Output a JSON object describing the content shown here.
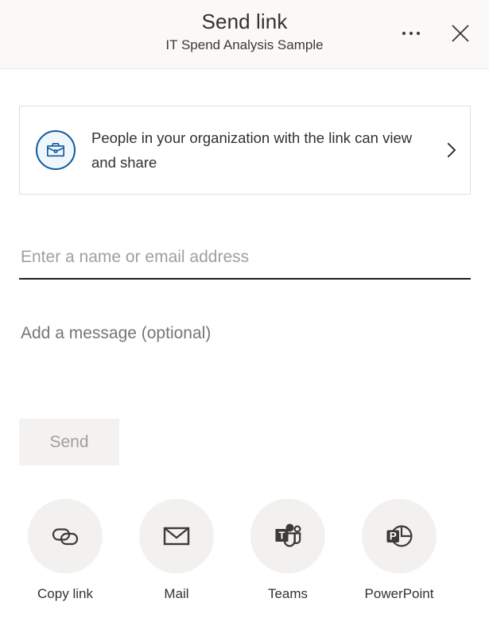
{
  "header": {
    "title": "Send link",
    "subtitle": "IT Spend Analysis Sample",
    "more_icon": "ellipsis-icon",
    "close_icon": "close-icon",
    "background": "#faf9f8"
  },
  "permission": {
    "icon": "briefcase-icon",
    "icon_color": "#0f5a9e",
    "icon_background": "#eff6fc",
    "text": "People in your organization with the link can view and share",
    "chevron_icon": "chevron-right-icon"
  },
  "recipient": {
    "placeholder": "Enter a name or email address",
    "value": ""
  },
  "message": {
    "placeholder": "Add a message (optional)",
    "value": ""
  },
  "send": {
    "label": "Send",
    "enabled": false,
    "background": "#f3f2f1",
    "text_color": "#a19f9d"
  },
  "share_actions": [
    {
      "label": "Copy link",
      "icon": "link-chain-icon"
    },
    {
      "label": "Mail",
      "icon": "envelope-icon"
    },
    {
      "label": "Teams",
      "icon": "teams-icon"
    },
    {
      "label": "PowerPoint",
      "icon": "powerpoint-icon"
    }
  ]
}
